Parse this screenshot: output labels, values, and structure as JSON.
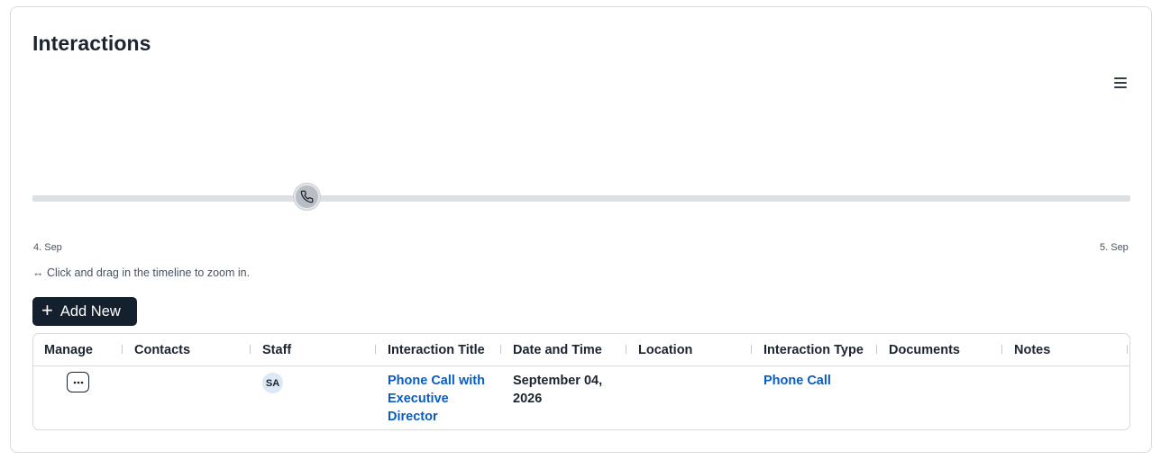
{
  "panel": {
    "title": "Interactions"
  },
  "timeline": {
    "start_label": "4. Sep",
    "end_label": "5. Sep",
    "hint": "↔ Click and drag in the timeline to zoom in.",
    "marker_icon": "phone-icon"
  },
  "toolbar": {
    "add_new_label": "Add New",
    "add_icon": "plus-icon"
  },
  "table": {
    "columns": [
      "Manage",
      "Contacts",
      "Staff",
      "Interaction Title",
      "Date and Time",
      "Location",
      "Interaction Type",
      "Documents",
      "Notes"
    ],
    "rows": [
      {
        "manage_icon": "ellipsis-icon",
        "contacts": "",
        "staff_initials": "SA",
        "title_line1": "Phone Call with",
        "title_line2": "Executive",
        "title_line3": "Director",
        "date_line1": "September 04,",
        "date_line2": "2026",
        "location": "",
        "type": "Phone Call",
        "documents": "",
        "notes": ""
      }
    ]
  }
}
